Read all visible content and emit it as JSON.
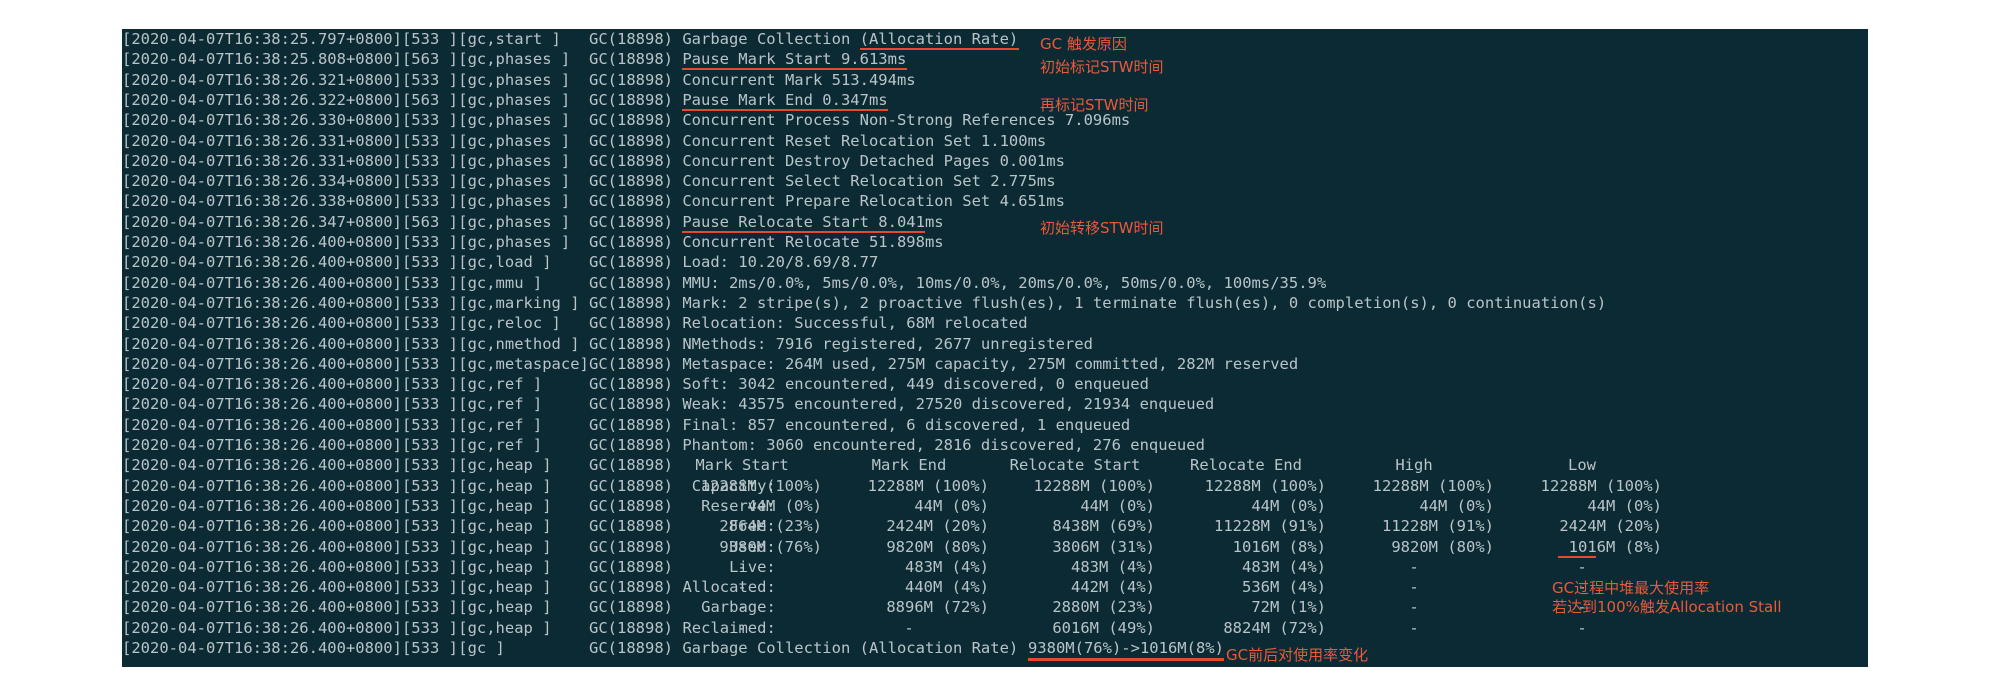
{
  "log_lines": [
    {
      "ts": "[2020-04-07T16:38:25.797+0800][533 ]",
      "tag": "[gc,start ]",
      "msg": "GC(18898) Garbage Collection (Allocation Rate)"
    },
    {
      "ts": "[2020-04-07T16:38:25.808+0800][563 ]",
      "tag": "[gc,phases ]",
      "msg": "GC(18898) Pause Mark Start 9.613ms"
    },
    {
      "ts": "[2020-04-07T16:38:26.321+0800][533 ]",
      "tag": "[gc,phases ]",
      "msg": "GC(18898) Concurrent Mark 513.494ms"
    },
    {
      "ts": "[2020-04-07T16:38:26.322+0800][563 ]",
      "tag": "[gc,phases ]",
      "msg": "GC(18898) Pause Mark End 0.347ms"
    },
    {
      "ts": "[2020-04-07T16:38:26.330+0800][533 ]",
      "tag": "[gc,phases ]",
      "msg": "GC(18898) Concurrent Process Non-Strong References 7.096ms"
    },
    {
      "ts": "[2020-04-07T16:38:26.331+0800][533 ]",
      "tag": "[gc,phases ]",
      "msg": "GC(18898) Concurrent Reset Relocation Set 1.100ms"
    },
    {
      "ts": "[2020-04-07T16:38:26.331+0800][533 ]",
      "tag": "[gc,phases ]",
      "msg": "GC(18898) Concurrent Destroy Detached Pages 0.001ms"
    },
    {
      "ts": "[2020-04-07T16:38:26.334+0800][533 ]",
      "tag": "[gc,phases ]",
      "msg": "GC(18898) Concurrent Select Relocation Set 2.775ms"
    },
    {
      "ts": "[2020-04-07T16:38:26.338+0800][533 ]",
      "tag": "[gc,phases ]",
      "msg": "GC(18898) Concurrent Prepare Relocation Set 4.651ms"
    },
    {
      "ts": "[2020-04-07T16:38:26.347+0800][563 ]",
      "tag": "[gc,phases ]",
      "msg": "GC(18898) Pause Relocate Start 8.041ms"
    },
    {
      "ts": "[2020-04-07T16:38:26.400+0800][533 ]",
      "tag": "[gc,phases ]",
      "msg": "GC(18898) Concurrent Relocate 51.898ms"
    },
    {
      "ts": "[2020-04-07T16:38:26.400+0800][533 ]",
      "tag": "[gc,load ]",
      "msg": "GC(18898) Load: 10.20/8.69/8.77"
    },
    {
      "ts": "[2020-04-07T16:38:26.400+0800][533 ]",
      "tag": "[gc,mmu ]",
      "msg": "GC(18898) MMU: 2ms/0.0%, 5ms/0.0%, 10ms/0.0%, 20ms/0.0%, 50ms/0.0%, 100ms/35.9%"
    },
    {
      "ts": "[2020-04-07T16:38:26.400+0800][533 ]",
      "tag": "[gc,marking ]",
      "msg": "GC(18898) Mark: 2 stripe(s), 2 proactive flush(es), 1 terminate flush(es), 0 completion(s), 0 continuation(s)"
    },
    {
      "ts": "[2020-04-07T16:38:26.400+0800][533 ]",
      "tag": "[gc,reloc ]",
      "msg": "GC(18898) Relocation: Successful, 68M relocated"
    },
    {
      "ts": "[2020-04-07T16:38:26.400+0800][533 ]",
      "tag": "[gc,nmethod ]",
      "msg": "GC(18898) NMethods: 7916 registered, 2677 unregistered"
    },
    {
      "ts": "[2020-04-07T16:38:26.400+0800][533 ]",
      "tag": "[gc,metaspace]",
      "msg": "GC(18898) Metaspace: 264M used, 275M capacity, 275M committed, 282M reserved"
    },
    {
      "ts": "[2020-04-07T16:38:26.400+0800][533 ]",
      "tag": "[gc,ref ]",
      "msg": "GC(18898) Soft: 3042 encountered, 449 discovered, 0 enqueued"
    },
    {
      "ts": "[2020-04-07T16:38:26.400+0800][533 ]",
      "tag": "[gc,ref ]",
      "msg": "GC(18898) Weak: 43575 encountered, 27520 discovered, 21934 enqueued"
    },
    {
      "ts": "[2020-04-07T16:38:26.400+0800][533 ]",
      "tag": "[gc,ref ]",
      "msg": "GC(18898) Final: 857 encountered, 6 discovered, 1 enqueued"
    },
    {
      "ts": "[2020-04-07T16:38:26.400+0800][533 ]",
      "tag": "[gc,ref ]",
      "msg": "GC(18898) Phantom: 3060 encountered, 2816 discovered, 276 enqueued"
    }
  ],
  "heap_prefix": {
    "ts": "[2020-04-07T16:38:26.400+0800][533 ]",
    "tag": "[gc,heap ]",
    "gc": "GC(18898)"
  },
  "heap_headers": [
    "Mark Start",
    "Mark End",
    "Relocate Start",
    "Relocate End",
    "High",
    "Low"
  ],
  "heap_rows": [
    {
      "label": "Capacity:",
      "cells": [
        "12288M (100%)",
        "12288M (100%)",
        "12288M (100%)",
        "12288M (100%)",
        "12288M (100%)",
        "12288M (100%)"
      ]
    },
    {
      "label": "Reserve:",
      "cells": [
        "44M (0%)",
        "44M (0%)",
        "44M (0%)",
        "44M (0%)",
        "44M (0%)",
        "44M (0%)"
      ]
    },
    {
      "label": "Free:",
      "cells": [
        "2864M (23%)",
        "2424M (20%)",
        "8438M (69%)",
        "11228M (91%)",
        "11228M (91%)",
        "2424M (20%)"
      ]
    },
    {
      "label": "Used:",
      "cells": [
        "9380M (76%)",
        "9820M (80%)",
        "3806M (31%)",
        "1016M (8%)",
        "9820M (80%)",
        "1016M (8%)"
      ]
    },
    {
      "label": "Live:",
      "cells": [
        "-",
        "483M (4%)",
        "483M (4%)",
        "483M (4%)",
        "-",
        "-"
      ]
    },
    {
      "label": "Allocated:",
      "cells": [
        "-",
        "440M (4%)",
        "442M (4%)",
        "536M (4%)",
        "-",
        "-"
      ]
    },
    {
      "label": "Garbage:",
      "cells": [
        "-",
        "8896M (72%)",
        "2880M (23%)",
        "72M (1%)",
        "-",
        "-"
      ]
    },
    {
      "label": "Reclaimed:",
      "cells": [
        "-",
        "-",
        "6016M (49%)",
        "8824M (72%)",
        "-",
        "-"
      ]
    }
  ],
  "last_line": {
    "ts": "[2020-04-07T16:38:26.400+0800][533 ]",
    "tag": "[gc ]",
    "msg": "GC(18898) Garbage Collection (Allocation Rate)",
    "highlight": "9380M(76%)->1016M(8%)"
  },
  "annotations": {
    "gc_cause": "GC 触发原因",
    "mark_start_stw": "初始标记STW时间",
    "mark_end_stw": "再标记STW时间",
    "relocate_start_stw": "初始转移STW时间",
    "max_usage_1": "GC过程中堆最大使用率",
    "max_usage_2": "若达到100%触发Allocation Stall",
    "usage_change": "GC前后对使用率变化"
  },
  "colors": {
    "terminal_bg": "#0b2a33",
    "text": "#b9c4c8",
    "annotation": "#ea5a3a"
  }
}
